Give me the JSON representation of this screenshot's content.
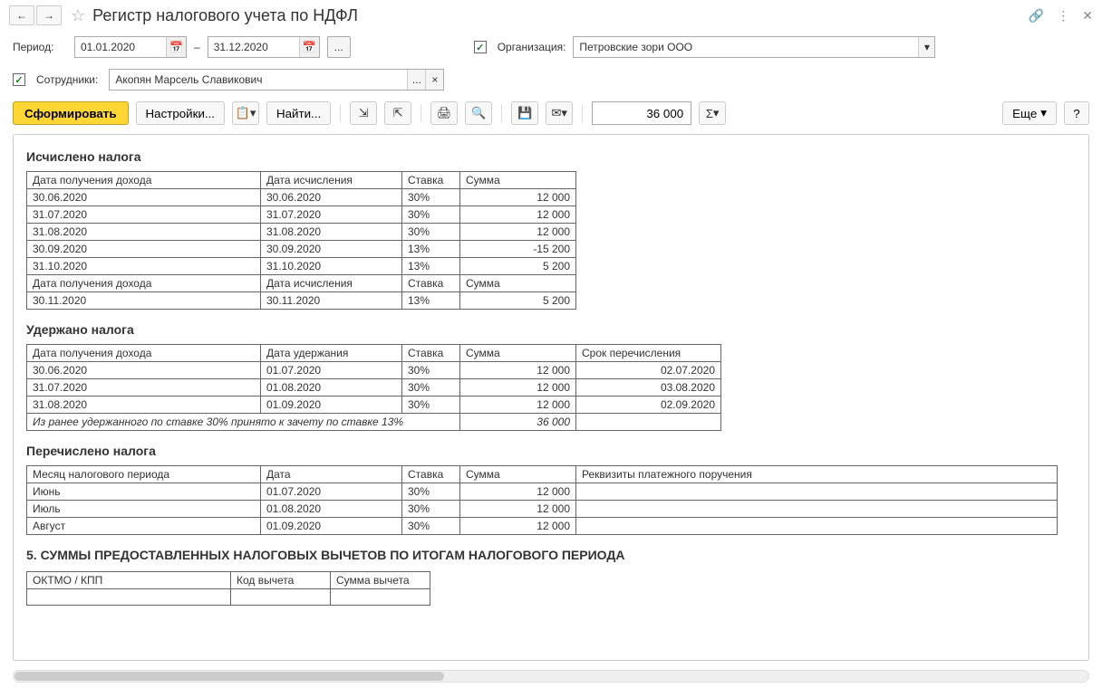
{
  "title": "Регистр налогового учета по НДФЛ",
  "period_label": "Период:",
  "date_from": "01.01.2020",
  "date_to": "31.12.2020",
  "dash": "–",
  "org_label": "Организация:",
  "org_value": "Петровские зори ООО",
  "emp_label": "Сотрудники:",
  "emp_value": "Акопян Марсель Славикович",
  "ellipsis": "...",
  "x": "×",
  "btn_generate": "Сформировать",
  "btn_settings": "Настройки...",
  "btn_find": "Найти...",
  "btn_more": "Еще",
  "btn_help": "?",
  "number_value": "36 000",
  "sigma": "Σ",
  "sec1": "Исчислено налога",
  "sec2": "Удержано налога",
  "sec3": "Перечислено налога",
  "sec4": "5. СУММЫ ПРЕДОСТАВЛЕННЫХ НАЛОГОВЫХ ВЫЧЕТОВ ПО ИТОГАМ НАЛОГОВОГО ПЕРИОДА",
  "h_income_date": "Дата получения дохода",
  "h_calc_date": "Дата исчисления",
  "h_withhold_date": "Дата удержания",
  "h_rate": "Ставка",
  "h_sum": "Сумма",
  "h_transfer_due": "Срок перечисления",
  "h_month": "Месяц налогового периода",
  "h_date": "Дата",
  "h_payment": "Реквизиты платежного поручения",
  "h_oktmo": "ОКТМО / КПП",
  "h_deduct_code": "Код вычета",
  "h_deduct_sum": "Сумма вычета",
  "t1": [
    {
      "d1": "30.06.2020",
      "d2": "30.06.2020",
      "r": "30%",
      "s": "12 000"
    },
    {
      "d1": "31.07.2020",
      "d2": "31.07.2020",
      "r": "30%",
      "s": "12 000"
    },
    {
      "d1": "31.08.2020",
      "d2": "31.08.2020",
      "r": "30%",
      "s": "12 000"
    },
    {
      "d1": "30.09.2020",
      "d2": "30.09.2020",
      "r": "13%",
      "s": "-15 200"
    },
    {
      "d1": "31.10.2020",
      "d2": "31.10.2020",
      "r": "13%",
      "s": "5 200"
    }
  ],
  "t1b": {
    "d1": "30.11.2020",
    "d2": "30.11.2020",
    "r": "13%",
    "s": "5 200"
  },
  "t2": [
    {
      "d1": "30.06.2020",
      "d2": "01.07.2020",
      "r": "30%",
      "s": "12 000",
      "due": "02.07.2020"
    },
    {
      "d1": "31.07.2020",
      "d2": "01.08.2020",
      "r": "30%",
      "s": "12 000",
      "due": "03.08.2020"
    },
    {
      "d1": "31.08.2020",
      "d2": "01.09.2020",
      "r": "30%",
      "s": "12 000",
      "due": "02.09.2020"
    }
  ],
  "t2_note": "Из ранее удержанного по ставке 30% принято к зачету по ставке 13%",
  "t2_note_sum": "36 000",
  "t3": [
    {
      "m": "Июнь",
      "d": "01.07.2020",
      "r": "30%",
      "s": "12 000",
      "p": ""
    },
    {
      "m": "Июль",
      "d": "01.08.2020",
      "r": "30%",
      "s": "12 000",
      "p": ""
    },
    {
      "m": "Август",
      "d": "01.09.2020",
      "r": "30%",
      "s": "12 000",
      "p": ""
    }
  ]
}
